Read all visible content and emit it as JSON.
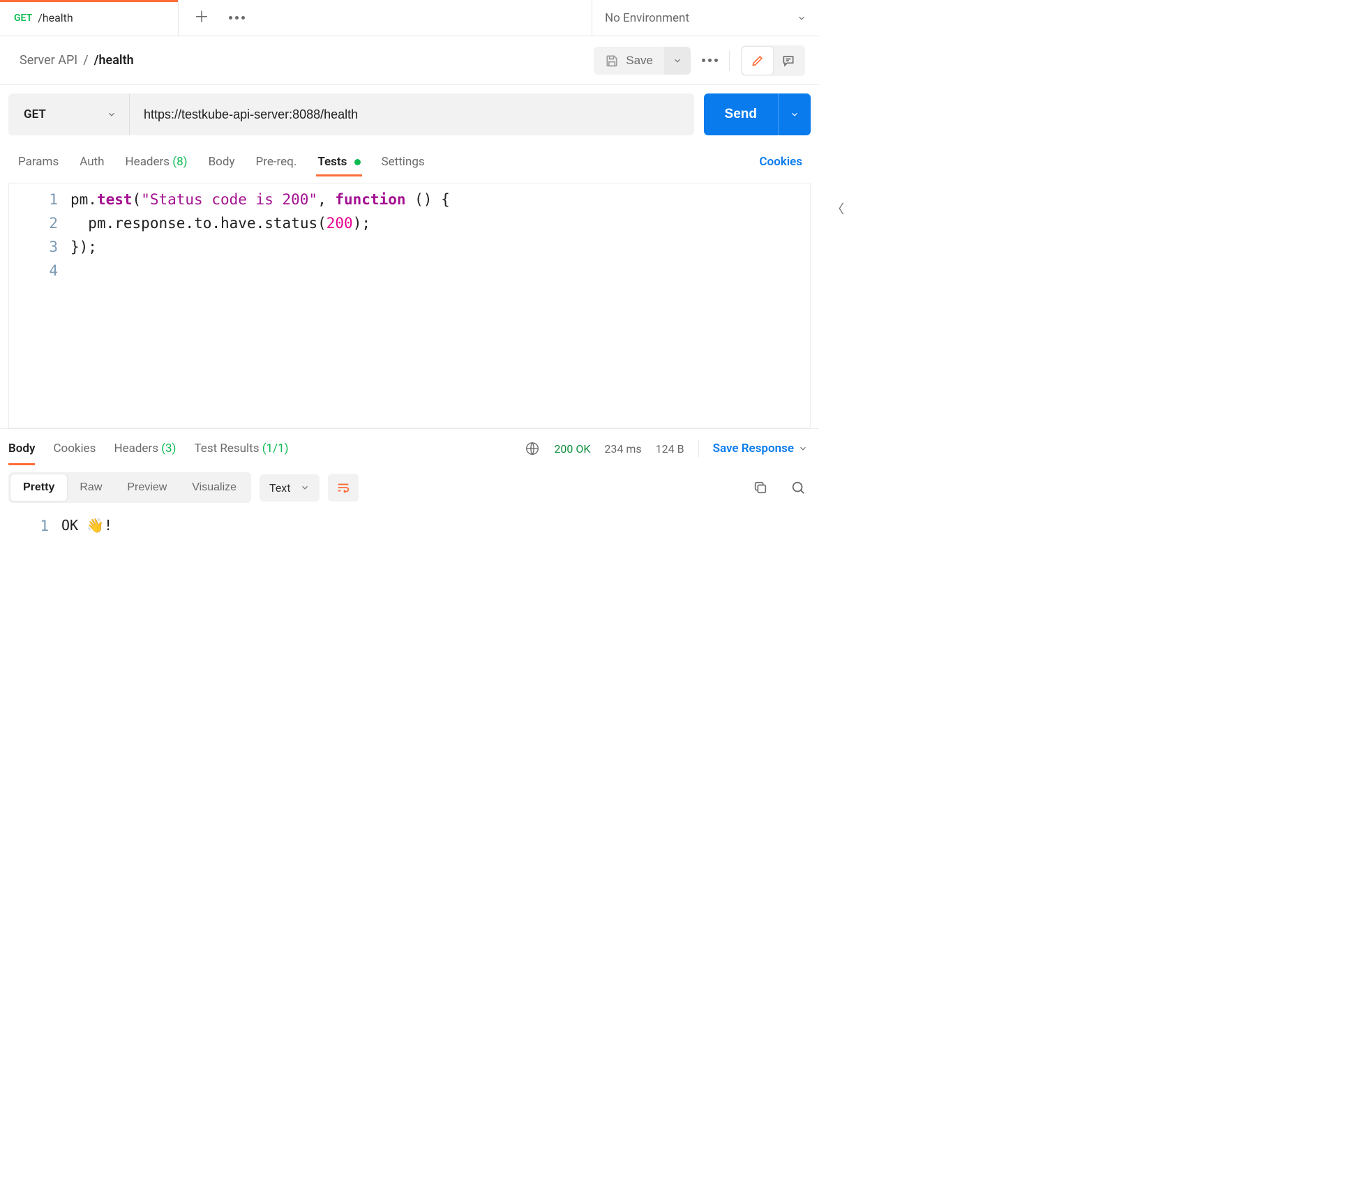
{
  "tab": {
    "method": "GET",
    "title": "/health"
  },
  "env": {
    "label": "No Environment"
  },
  "breadcrumb": {
    "root": "Server API",
    "sep": "/",
    "current": "/health"
  },
  "header": {
    "save": "Save"
  },
  "request": {
    "method": "GET",
    "url": "https://testkube-api-server:8088/health",
    "send": "Send",
    "tabs": {
      "params": "Params",
      "auth": "Auth",
      "headers": "Headers",
      "headers_count": "(8)",
      "body": "Body",
      "prereq": "Pre-req.",
      "tests": "Tests",
      "settings": "Settings"
    },
    "cookies_link": "Cookies"
  },
  "editor": {
    "lines": [
      "1",
      "2",
      "3",
      "4"
    ],
    "tokens": {
      "pm": "pm",
      "test": "test",
      "string": "\"Status code is 200\"",
      "function": "function",
      "response": "response",
      "to": "to",
      "have": "have",
      "status": "status",
      "num": "200"
    }
  },
  "response": {
    "tabs": {
      "body": "Body",
      "cookies": "Cookies",
      "headers": "Headers",
      "headers_count": "(3)",
      "test_results": "Test Results",
      "test_results_count": "(1/1)"
    },
    "status": "200 OK",
    "time": "234 ms",
    "size": "124 B",
    "save_response": "Save Response",
    "views": {
      "pretty": "Pretty",
      "raw": "Raw",
      "preview": "Preview",
      "visualize": "Visualize"
    },
    "format": "Text",
    "body_lines": [
      "1"
    ],
    "body_text": "OK 👋!"
  }
}
